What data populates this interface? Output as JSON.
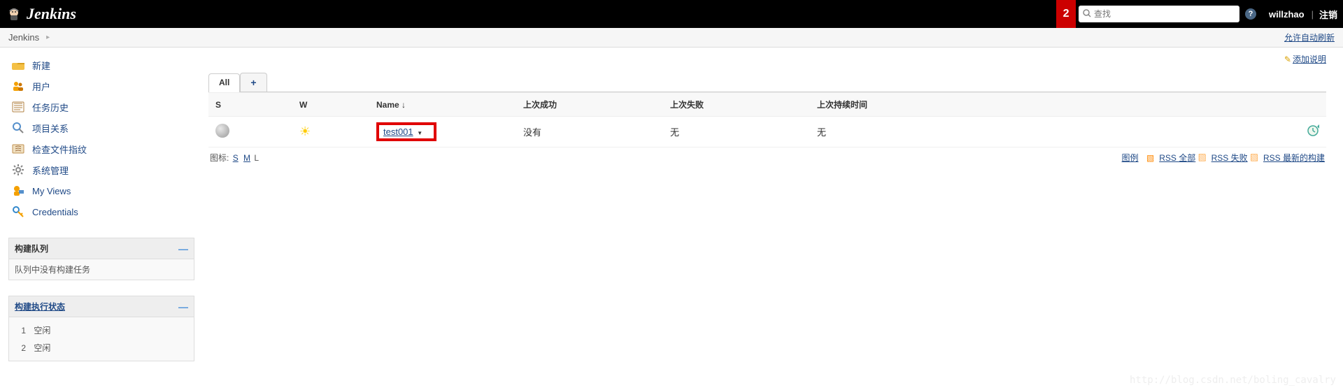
{
  "header": {
    "brand": "Jenkins",
    "notif_count": "2",
    "search_placeholder": "查找",
    "user": "willzhao",
    "logout": "注销"
  },
  "breadcrumb": {
    "root": "Jenkins",
    "auto_refresh": "允许自动刷新"
  },
  "sidebar": {
    "items": [
      {
        "label": "新建"
      },
      {
        "label": "用户"
      },
      {
        "label": "任务历史"
      },
      {
        "label": "项目关系"
      },
      {
        "label": "检查文件指纹"
      },
      {
        "label": "系统管理"
      },
      {
        "label": "My Views"
      },
      {
        "label": "Credentials"
      }
    ],
    "build_queue": {
      "title": "构建队列",
      "empty": "队列中没有构建任务"
    },
    "executors": {
      "title": "构建执行状态",
      "rows": [
        {
          "num": "1",
          "state": "空闲"
        },
        {
          "num": "2",
          "state": "空闲"
        }
      ]
    }
  },
  "main": {
    "add_desc": "添加说明",
    "tabs": {
      "all": "All",
      "add": "+"
    },
    "columns": {
      "s": "S",
      "w": "W",
      "name": "Name  ↓",
      "last_success": "上次成功",
      "last_failure": "上次失败",
      "last_duration": "上次持续时间"
    },
    "jobs": [
      {
        "name": "test001",
        "last_success": "没有",
        "last_failure": "无",
        "last_duration": "无"
      }
    ],
    "icon_size": {
      "label": "图标:",
      "s": "S",
      "m": "M",
      "l": "L"
    },
    "rss": {
      "legend": "图例",
      "all": "RSS 全部",
      "fail": "RSS 失败",
      "latest": "RSS 最新的构建"
    }
  },
  "watermark": "http://blog.csdn.net/boling_cavalry"
}
